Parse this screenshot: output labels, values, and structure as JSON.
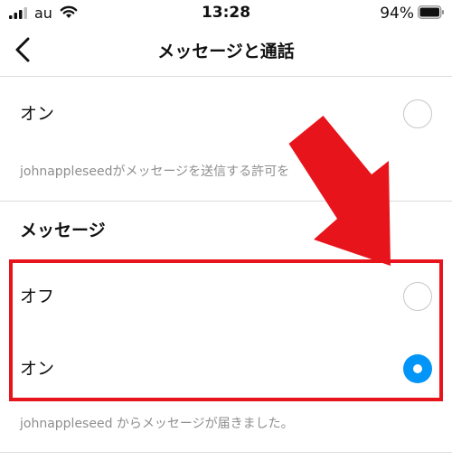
{
  "status_bar": {
    "carrier": "au",
    "time": "13:28",
    "battery_percent": "94%",
    "icons": [
      "signal-bars-icon",
      "wifi-icon",
      "battery-icon"
    ]
  },
  "nav": {
    "title": "メッセージと通話",
    "back_icon": "chevron-left-icon"
  },
  "top_section": {
    "option_label": "オン",
    "option_selected": false,
    "description": "johnappleseedがメッセージを送信する許可を　　います。"
  },
  "messages_section": {
    "title": "メッセージ",
    "options": [
      {
        "label": "オフ",
        "selected": false
      },
      {
        "label": "オン",
        "selected": true
      }
    ],
    "description": "johnappleseed からメッセージが届きました。"
  },
  "colors": {
    "accent_blue": "#0095f6",
    "annotation_red": "#e8141c",
    "divider": "#dbdbdb",
    "secondary_text": "#8e8e8e"
  },
  "annotation": {
    "arrow_icon": "red-arrow-pointer",
    "highlight": "red-rectangle-around-message-options"
  }
}
